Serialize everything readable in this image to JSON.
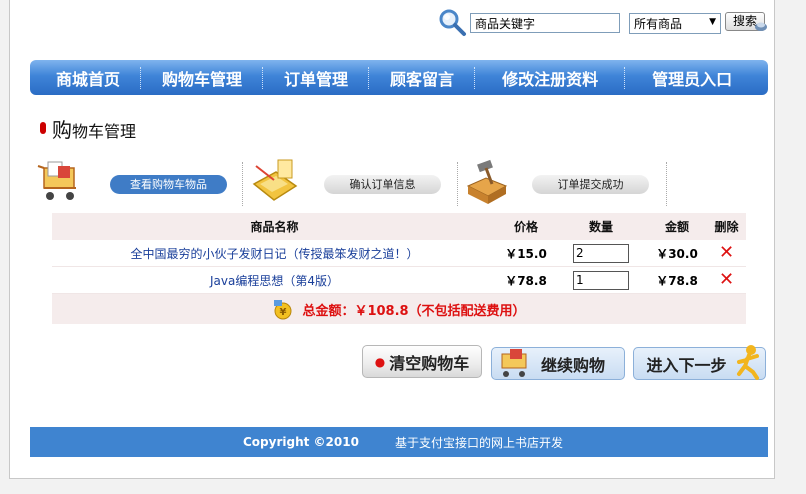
{
  "search": {
    "keyword_value": "商品关键字",
    "category_selected": "所有商品",
    "button_label": "搜索"
  },
  "nav": {
    "items": [
      "商城首页",
      "购物车管理",
      "订单管理",
      "顾客留言",
      "修改注册资料",
      "管理员入口"
    ]
  },
  "page": {
    "title_big": "购",
    "title_rest": "物车管理"
  },
  "steps": [
    {
      "label": "查看购物车物品",
      "icon": "cart-icon",
      "active": true
    },
    {
      "label": "确认订单信息",
      "icon": "calculator-icon",
      "active": false
    },
    {
      "label": "订单提交成功",
      "icon": "package-hammer-icon",
      "active": false
    }
  ],
  "cart": {
    "headers": {
      "name": "商品名称",
      "price": "价格",
      "qty": "数量",
      "amount": "金额",
      "delete": "删除"
    },
    "rows": [
      {
        "name": "全中国最穷的小伙子发财日记（传授最笨发财之道！）",
        "price": "￥15.0",
        "qty": "2",
        "amount": "￥30.0",
        "delete": "✕"
      },
      {
        "name": "Java编程思想（第4版）",
        "price": "￥78.8",
        "qty": "1",
        "amount": "￥78.8",
        "delete": "✕"
      }
    ],
    "total_text": "总金额：￥108.8（不包括配送费用）"
  },
  "buttons": {
    "clear_label": "清空购物车",
    "continue_label": "继续购物",
    "next_label": "进入下一步"
  },
  "footer": {
    "copyright": "Copyright ©2010",
    "description": "基于支付宝接口的网上书店开发"
  },
  "colors": {
    "nav_blue": "#3f84d8",
    "footer_blue": "#3f84d0",
    "accent_red": "#dd1111",
    "active_step": "#3f7cc6"
  }
}
